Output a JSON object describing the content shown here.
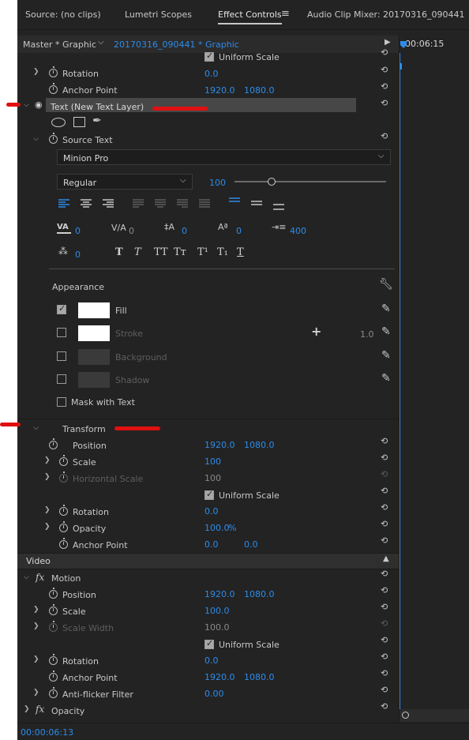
{
  "tabs": {
    "source": "Source: (no clips)",
    "lumetri": "Lumetri Scopes",
    "effect_controls": "Effect Controls",
    "menu_glyph": "≡",
    "audio_mixer": "Audio Clip Mixer: 20170316_090441"
  },
  "header": {
    "master": "Master * Graphic",
    "clip": "20170316_090441 * Graphic",
    "timecode": "00:06:15"
  },
  "top_rows": {
    "uniform_scale": "Uniform Scale",
    "rotation_label": "Rotation",
    "rotation_value": "0.0",
    "anchor_label": "Anchor Point",
    "anchor_x": "1920.0",
    "anchor_y": "1080.0"
  },
  "text_layer": {
    "name": "Text (New Text Layer)",
    "source_text": "Source Text",
    "font": "Minion Pro",
    "style": "Regular",
    "size": "100",
    "kerning": "0",
    "tracking": "0",
    "leading": "0",
    "baseline": "0",
    "tab_width": "400",
    "tsume": "0",
    "fmt_bold": "T",
    "fmt_italic": "T",
    "fmt_allcaps": "TT",
    "fmt_smallcaps": "Tт",
    "fmt_super": "T¹",
    "fmt_sub": "T₁",
    "fmt_underline": "T"
  },
  "appearance": {
    "heading": "Appearance",
    "fill": "Fill",
    "stroke": "Stroke",
    "stroke_width": "1.0",
    "background": "Background",
    "shadow": "Shadow",
    "mask": "Mask with Text",
    "fill_color": "#ffffff"
  },
  "transform": {
    "heading": "Transform",
    "position_label": "Position",
    "position_x": "1920.0",
    "position_y": "1080.0",
    "scale_label": "Scale",
    "scale_value": "100",
    "hscale_label": "Horizontal Scale",
    "hscale_value": "100",
    "uniform_scale": "Uniform Scale",
    "rotation_label": "Rotation",
    "rotation_value": "0.0",
    "opacity_label": "Opacity",
    "opacity_value": "100.0",
    "opacity_unit": "%",
    "anchor_label": "Anchor Point",
    "anchor_x": "0.0",
    "anchor_y": "0.0"
  },
  "video": {
    "heading": "Video",
    "fx": "fx",
    "motion": "Motion",
    "position_label": "Position",
    "position_x": "1920.0",
    "position_y": "1080.0",
    "scale_label": "Scale",
    "scale_value": "100.0",
    "scale_width_label": "Scale Width",
    "scale_width_value": "100.0",
    "uniform_scale": "Uniform Scale",
    "rotation_label": "Rotation",
    "rotation_value": "0.0",
    "anchor_label": "Anchor Point",
    "anchor_x": "1920.0",
    "anchor_y": "1080.0",
    "antiflicker_label": "Anti-flicker Filter",
    "antiflicker_value": "0.00",
    "opacity_label": "Opacity"
  },
  "footer": {
    "timecode": "00:00:06:13"
  },
  "colors": {
    "accent": "#2d8ceb",
    "annotation": "#e01010",
    "panel": "#232323"
  }
}
